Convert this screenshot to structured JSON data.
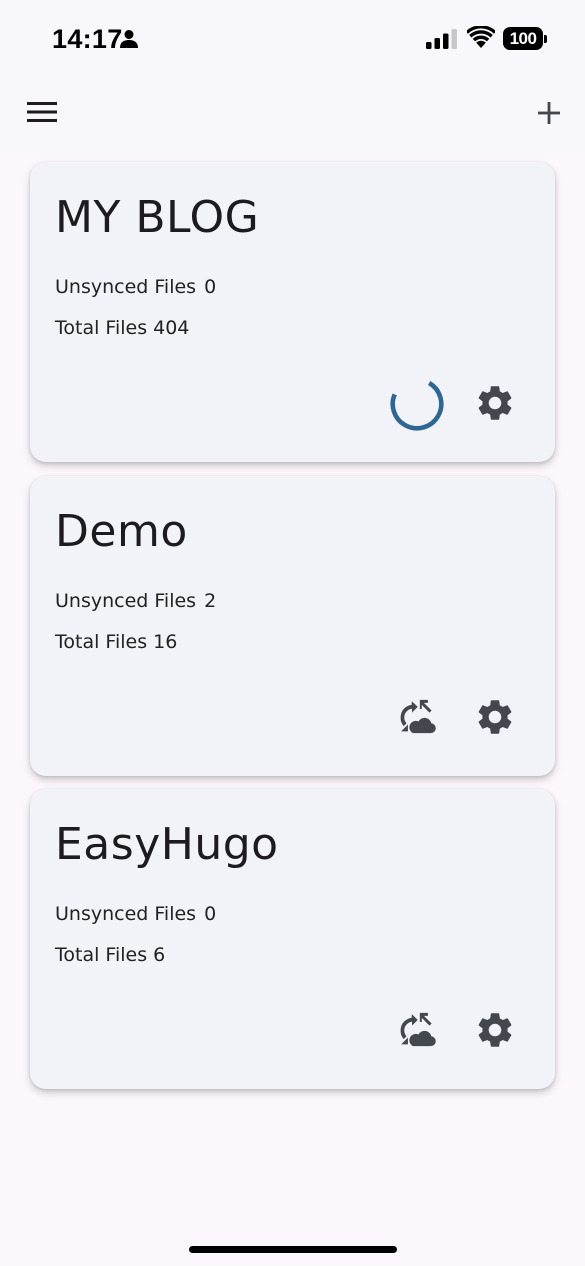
{
  "status_bar": {
    "time": "14:17",
    "battery": "100"
  },
  "app_bar": {
    "menu_icon": "menu-icon",
    "add_icon": "plus-icon"
  },
  "sites": [
    {
      "title": "MY BLOG",
      "unsynced_label": "Unsynced Files",
      "unsynced_count": "0",
      "total_label": "Total Files",
      "total_count": "404",
      "state": "syncing"
    },
    {
      "title": "Demo",
      "unsynced_label": "Unsynced Files",
      "unsynced_count": "2",
      "total_label": "Total Files",
      "total_count": "16",
      "state": "idle"
    },
    {
      "title": "EasyHugo",
      "unsynced_label": "Unsynced Files",
      "unsynced_count": "0",
      "total_label": "Total Files",
      "total_count": "6",
      "state": "idle"
    }
  ],
  "colors": {
    "spinner": "#2f6792",
    "icon": "#44474e",
    "card_background": "#f1f3f9",
    "page_background": "#fcf6fd"
  }
}
